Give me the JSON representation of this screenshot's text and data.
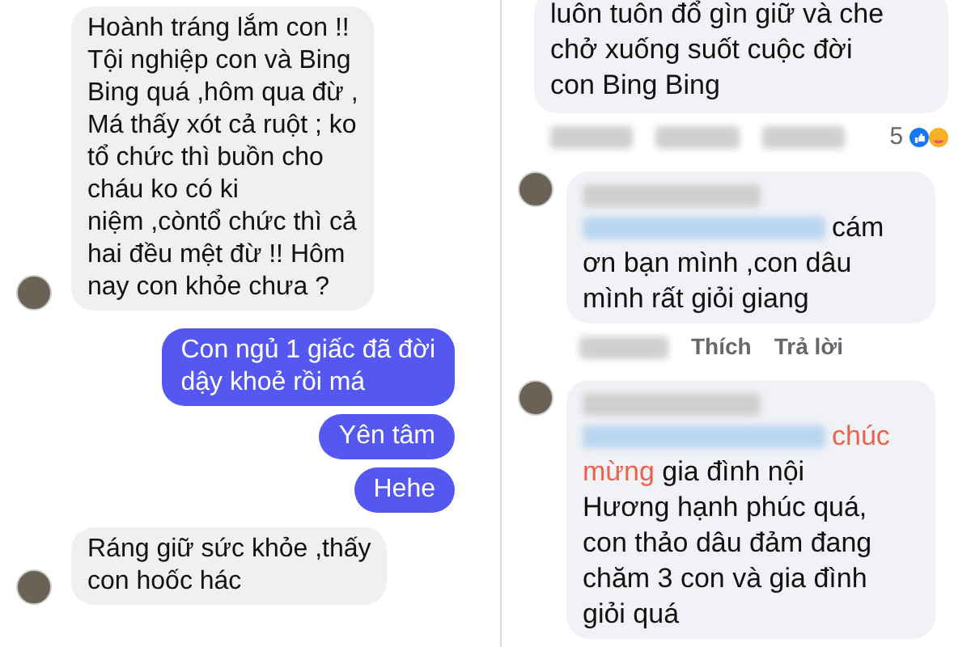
{
  "chat": {
    "messages": [
      {
        "kind": "incoming",
        "lines": [
          "Hoành tráng lắm con !!",
          "Tội nghiệp con và  Bing",
          "Bing quá ,hôm qua đừ ,",
          "Má thấy xót cả ruột ; ko",
          "tổ chức thì buồn cho",
          "cháu  ko có ki",
          "niệm ,còntổ chức thì  cả",
          "hai đều mệt đừ !! Hôm",
          "nay con khỏe chưa ?"
        ]
      },
      {
        "kind": "outgoing",
        "lines": [
          "Con ngủ 1 giấc đã đời",
          "dậy khoẻ rồi má"
        ]
      },
      {
        "kind": "outgoing",
        "lines": [
          "Yên tâm"
        ]
      },
      {
        "kind": "outgoing",
        "lines": [
          "Hehe"
        ]
      },
      {
        "kind": "incoming",
        "lines": [
          "Ráng giữ sức khỏe ,thấy",
          "con hoốc hác"
        ]
      }
    ]
  },
  "comments": {
    "top": {
      "lines": [
        [
          {
            "text": "luôn tuôn đổ gìn  giữ và che",
            "kind": "plain"
          }
        ],
        [
          {
            "text": "chở  xuống suốt cuộc đời",
            "kind": "plain"
          }
        ],
        [
          {
            "text": "con  Bing Bing",
            "kind": "plain"
          }
        ]
      ],
      "reaction_count": "5"
    },
    "items": [
      {
        "lines": [
          [
            {
              "text": "cám",
              "kind": "plain"
            }
          ],
          [
            {
              "text": "ơn bạn mình ,con dâu",
              "kind": "plain"
            }
          ],
          [
            {
              "text": "mình rất giỏi giang",
              "kind": "plain"
            }
          ]
        ],
        "actions": [
          "Thích",
          "Trả lời"
        ]
      },
      {
        "lines": [
          [
            {
              "text": "chúc",
              "kind": "highlight"
            }
          ],
          [
            {
              "text": "mừng",
              "kind": "highlight"
            },
            {
              "text": " gia đình nội",
              "kind": "plain"
            }
          ],
          [
            {
              "text": "Hương hạnh phúc quá,",
              "kind": "plain"
            }
          ],
          [
            {
              "text": "con thảo dâu đảm đang",
              "kind": "plain"
            }
          ],
          [
            {
              "text": "chăm 3 con và gia đình",
              "kind": "plain"
            }
          ],
          [
            {
              "text": "giỏi quá",
              "kind": "plain"
            }
          ]
        ]
      }
    ]
  }
}
